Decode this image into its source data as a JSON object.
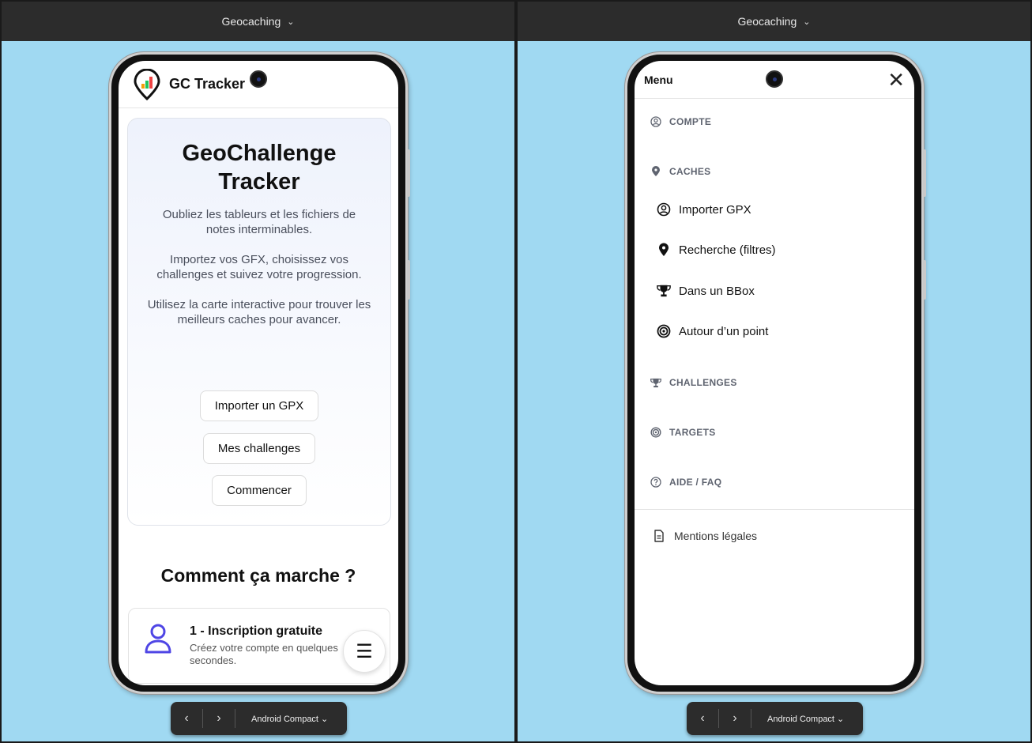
{
  "left": {
    "topbar_title": "Geocaching",
    "app": {
      "brand": "GC Tracker",
      "hero": {
        "title_line1": "GeoChallenge",
        "title_line2": "Tracker",
        "p1": "Oubliez les tableurs et les fichiers de notes interminables.",
        "p2": "Importez vos GFX, choisissez vos challenges et suivez votre progression.",
        "p3": "Utilisez la carte interactive pour trouver les meilleurs caches pour avancer.",
        "buttons": [
          "Importer un GPX",
          "Mes challenges",
          "Commencer"
        ]
      },
      "how_title": "Comment ça marche ?",
      "step1_title": "1 - Inscription gratuite",
      "step1_desc": "Créez votre compte en quelques secondes."
    },
    "dock_device": "Android Compact"
  },
  "right": {
    "topbar_title": "Geocaching",
    "menu_title": "Menu",
    "sections": {
      "compte": "COMPTE",
      "caches": "CACHES",
      "challenges": "CHALLENGES",
      "targets": "TARGETS",
      "aide": "AIDE / FAQ"
    },
    "cache_items": [
      "Importer GPX",
      "Recherche (filtres)",
      "Dans un BBox",
      "Autour d’un point"
    ],
    "legal": "Mentions légales",
    "dock_device": "Android Compact"
  },
  "colors": {
    "stage_bg": "#a0d9f2",
    "chrome": "#2c2c2c",
    "accent_purple": "#4f46e5"
  }
}
